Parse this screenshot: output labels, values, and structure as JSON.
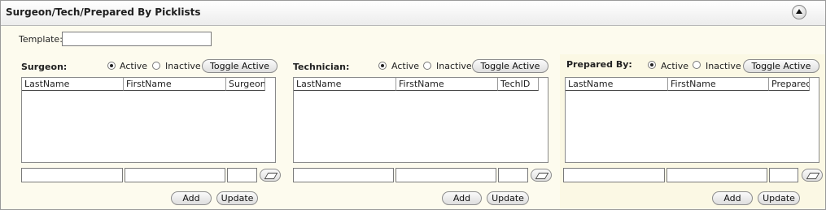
{
  "header": {
    "title": "Surgeon/Tech/Prepared By Picklists"
  },
  "template": {
    "label": "Template:",
    "value": ""
  },
  "active_label": "Active",
  "inactive_label": "Inactive",
  "toggle_label": "Toggle Active",
  "add_label": "Add",
  "update_label": "Update",
  "panels": [
    {
      "label": "Surgeon:",
      "columns": [
        "LastName",
        "FirstName",
        "Surgeon"
      ],
      "active_selected": true
    },
    {
      "label": "Technician:",
      "columns": [
        "LastName",
        "FirstName",
        "TechID"
      ],
      "active_selected": true
    },
    {
      "label": "Prepared By:",
      "columns": [
        "LastName",
        "FirstName",
        "Preparec"
      ],
      "active_selected": true
    }
  ]
}
